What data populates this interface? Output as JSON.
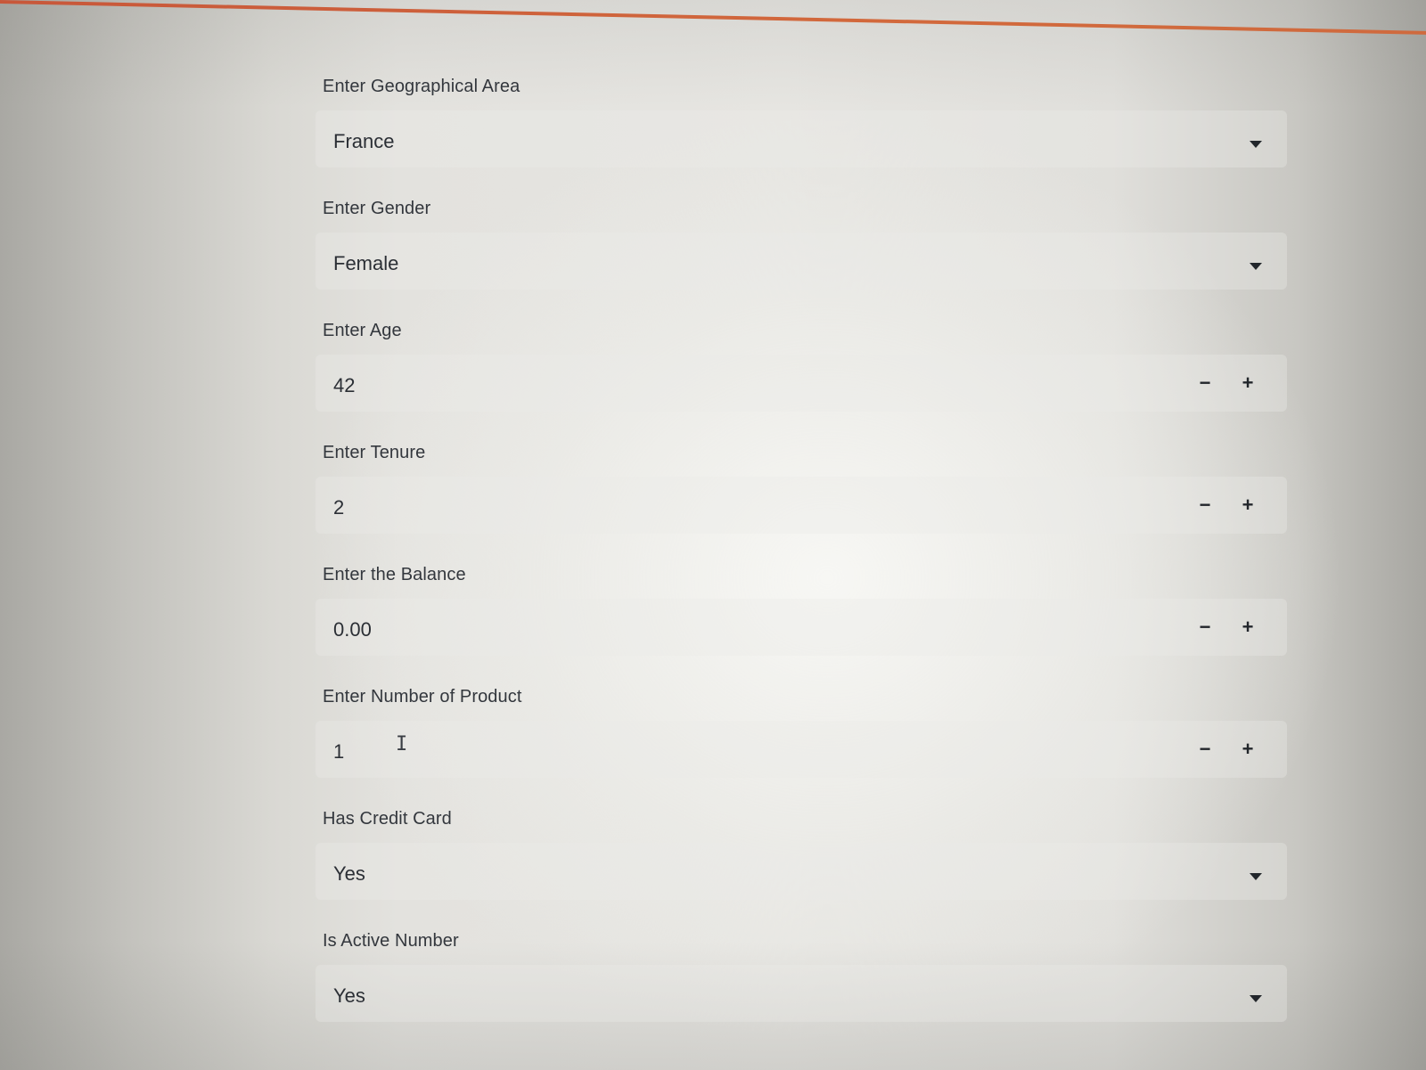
{
  "form": {
    "geo": {
      "label": "Enter Geographical Area",
      "value": "France"
    },
    "gender": {
      "label": "Enter Gender",
      "value": "Female"
    },
    "age": {
      "label": "Enter Age",
      "value": "42"
    },
    "tenure": {
      "label": "Enter Tenure",
      "value": "2"
    },
    "balance": {
      "label": "Enter the Balance",
      "value": "0.00"
    },
    "products": {
      "label": "Enter Number of Product",
      "value": "1"
    },
    "credit_card": {
      "label": "Has Credit Card",
      "value": "Yes"
    },
    "active": {
      "label": "Is Active Number",
      "value": "Yes"
    }
  },
  "controls": {
    "minus": "−",
    "plus": "+",
    "dropdown_icon": "caret-down-icon",
    "text_cursor": "I"
  },
  "colors": {
    "accent": "#d2693c",
    "text": "#2e3238"
  }
}
